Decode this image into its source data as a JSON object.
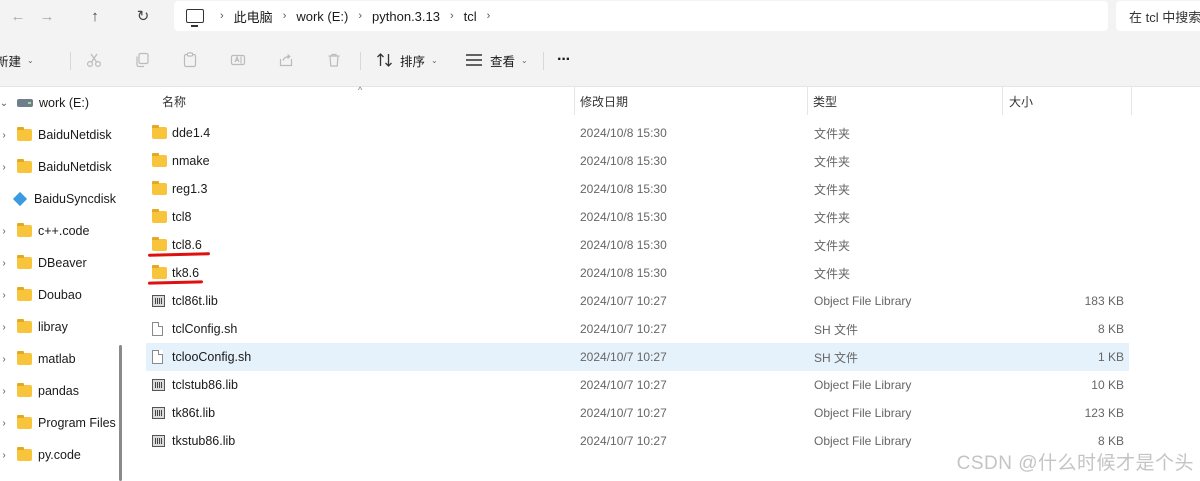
{
  "nav": {
    "back_glyph": "←",
    "forward_glyph": "→",
    "up_glyph": "↑",
    "refresh_glyph": "↻"
  },
  "breadcrumb": [
    "此电脑",
    "work (E:)",
    "python.3.13",
    "tcl"
  ],
  "breadcrumb_sep": "›",
  "search": {
    "placeholder": "在 tcl 中搜索"
  },
  "toolbar": {
    "new_label": "新建",
    "sort_label": "排序",
    "view_label": "查看",
    "more_label": "···",
    "caret": "⌄"
  },
  "sidebar": {
    "items": [
      {
        "label": "work (E:)",
        "icon": "drive-icon",
        "chevron": "⌄"
      },
      {
        "label": "BaiduNetdisk",
        "icon": "folder-icon",
        "chevron": "›"
      },
      {
        "label": "BaiduNetdisk",
        "icon": "folder-icon",
        "chevron": "›"
      },
      {
        "label": "BaiduSyncdisk",
        "icon": "baidu-sync-icon",
        "chevron": ""
      },
      {
        "label": "c++.code",
        "icon": "folder-icon",
        "chevron": "›"
      },
      {
        "label": "DBeaver",
        "icon": "folder-icon",
        "chevron": "›"
      },
      {
        "label": "Doubao",
        "icon": "folder-icon",
        "chevron": "›"
      },
      {
        "label": "libray",
        "icon": "folder-icon",
        "chevron": "›"
      },
      {
        "label": "matlab",
        "icon": "folder-icon",
        "chevron": "›"
      },
      {
        "label": "pandas",
        "icon": "folder-icon",
        "chevron": "›"
      },
      {
        "label": "Program Files",
        "icon": "folder-icon",
        "chevron": "›"
      },
      {
        "label": "py.code",
        "icon": "folder-icon",
        "chevron": "›"
      }
    ]
  },
  "columns": {
    "name": "名称",
    "date": "修改日期",
    "type": "类型",
    "size": "大小",
    "sort_glyph": "^"
  },
  "files": [
    {
      "name": "dde1.4",
      "date": "2024/10/8 15:30",
      "type": "文件夹",
      "size": "",
      "icon": "folder"
    },
    {
      "name": "nmake",
      "date": "2024/10/8 15:30",
      "type": "文件夹",
      "size": "",
      "icon": "folder"
    },
    {
      "name": "reg1.3",
      "date": "2024/10/8 15:30",
      "type": "文件夹",
      "size": "",
      "icon": "folder"
    },
    {
      "name": "tcl8",
      "date": "2024/10/8 15:30",
      "type": "文件夹",
      "size": "",
      "icon": "folder"
    },
    {
      "name": "tcl8.6",
      "date": "2024/10/8 15:30",
      "type": "文件夹",
      "size": "",
      "icon": "folder",
      "underlined": true
    },
    {
      "name": "tk8.6",
      "date": "2024/10/8 15:30",
      "type": "文件夹",
      "size": "",
      "icon": "folder",
      "underlined": true
    },
    {
      "name": "tcl86t.lib",
      "date": "2024/10/7 10:27",
      "type": "Object File Library",
      "size": "183 KB",
      "icon": "lib"
    },
    {
      "name": "tclConfig.sh",
      "date": "2024/10/7 10:27",
      "type": "SH 文件",
      "size": "8 KB",
      "icon": "file"
    },
    {
      "name": "tclooConfig.sh",
      "date": "2024/10/7 10:27",
      "type": "SH 文件",
      "size": "1 KB",
      "icon": "file",
      "selected": true
    },
    {
      "name": "tclstub86.lib",
      "date": "2024/10/7 10:27",
      "type": "Object File Library",
      "size": "10 KB",
      "icon": "lib"
    },
    {
      "name": "tk86t.lib",
      "date": "2024/10/7 10:27",
      "type": "Object File Library",
      "size": "123 KB",
      "icon": "lib"
    },
    {
      "name": "tkstub86.lib",
      "date": "2024/10/7 10:27",
      "type": "Object File Library",
      "size": "8 KB",
      "icon": "lib"
    }
  ],
  "watermark": "CSDN @什么时候才是个头",
  "colors": {
    "selected_row": "#e5f1fb",
    "annotation_red": "#e01010",
    "folder": "#f8c43c"
  }
}
